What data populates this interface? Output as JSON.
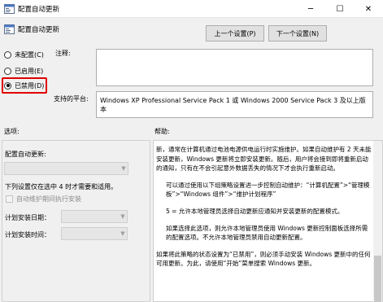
{
  "window": {
    "title": "配置自动更新",
    "minimize_glyph": "─",
    "maximize_glyph": "☐",
    "close_glyph": "✕"
  },
  "header": {
    "title": "配置自动更新",
    "prev_button": "上一个设置(P)",
    "next_button": "下一个设置(N)"
  },
  "state": {
    "options": [
      {
        "label": "未配置(C)",
        "checked": false
      },
      {
        "label": "已启用(E)",
        "checked": false
      },
      {
        "label": "已禁用(D)",
        "checked": true
      }
    ],
    "highlight_color": "#e00000"
  },
  "comment": {
    "label": "注释:",
    "value": ""
  },
  "platform": {
    "label": "支持的平台:",
    "value": "Windows XP Professional Service Pack 1 或 Windows 2000 Service Pack 3 及以上版本"
  },
  "options_section": {
    "label": "选项:",
    "configure_label": "配置自动更新:",
    "configure_value": "",
    "note": "下列设置仅在选中 4 时才需要和适用。",
    "checkbox_label": "自动维护期间执行安装",
    "schedule_day_label": "计划安装日期：",
    "schedule_day_value": "",
    "schedule_time_label": "计划安装时间：",
    "schedule_time_value": ""
  },
  "help_section": {
    "label": "帮助:",
    "paragraphs": [
      "新，通常在计算机通过电池电源供电运行时实施维护。如果自动维护有 2 天未能安装更新，Windows 更新将立即安装更新。随后，用户将会接到即将重新启动的通知，只有在不会引起意外数据丢失的情况下才会执行重新启动。",
      "可以通过使用以下组策略设置进一步控制自动维护：“计算机配置”>“管理模板”>“Windows 组件”>“维护计划程序”",
      "5 = 允许本地管理员选择自动更新应通知并安装更新的配置模式。",
      "如果选择此选项，则允许本地管理员使用 Windows 更新控制面板选择所需的配置选项。不允许本地管理员禁用自动更新配置。",
      "如果将此策略的状态设置为“已禁用”，则必须手动安装 Windows 更新中的任何可用更新。为此，请使用“开始”菜单搜索 Windows 更新。"
    ]
  },
  "colors": {
    "window_bg": "#f0f0f0",
    "button_bg": "#e1e1e1",
    "disabled_text": "#8c8c8c"
  }
}
